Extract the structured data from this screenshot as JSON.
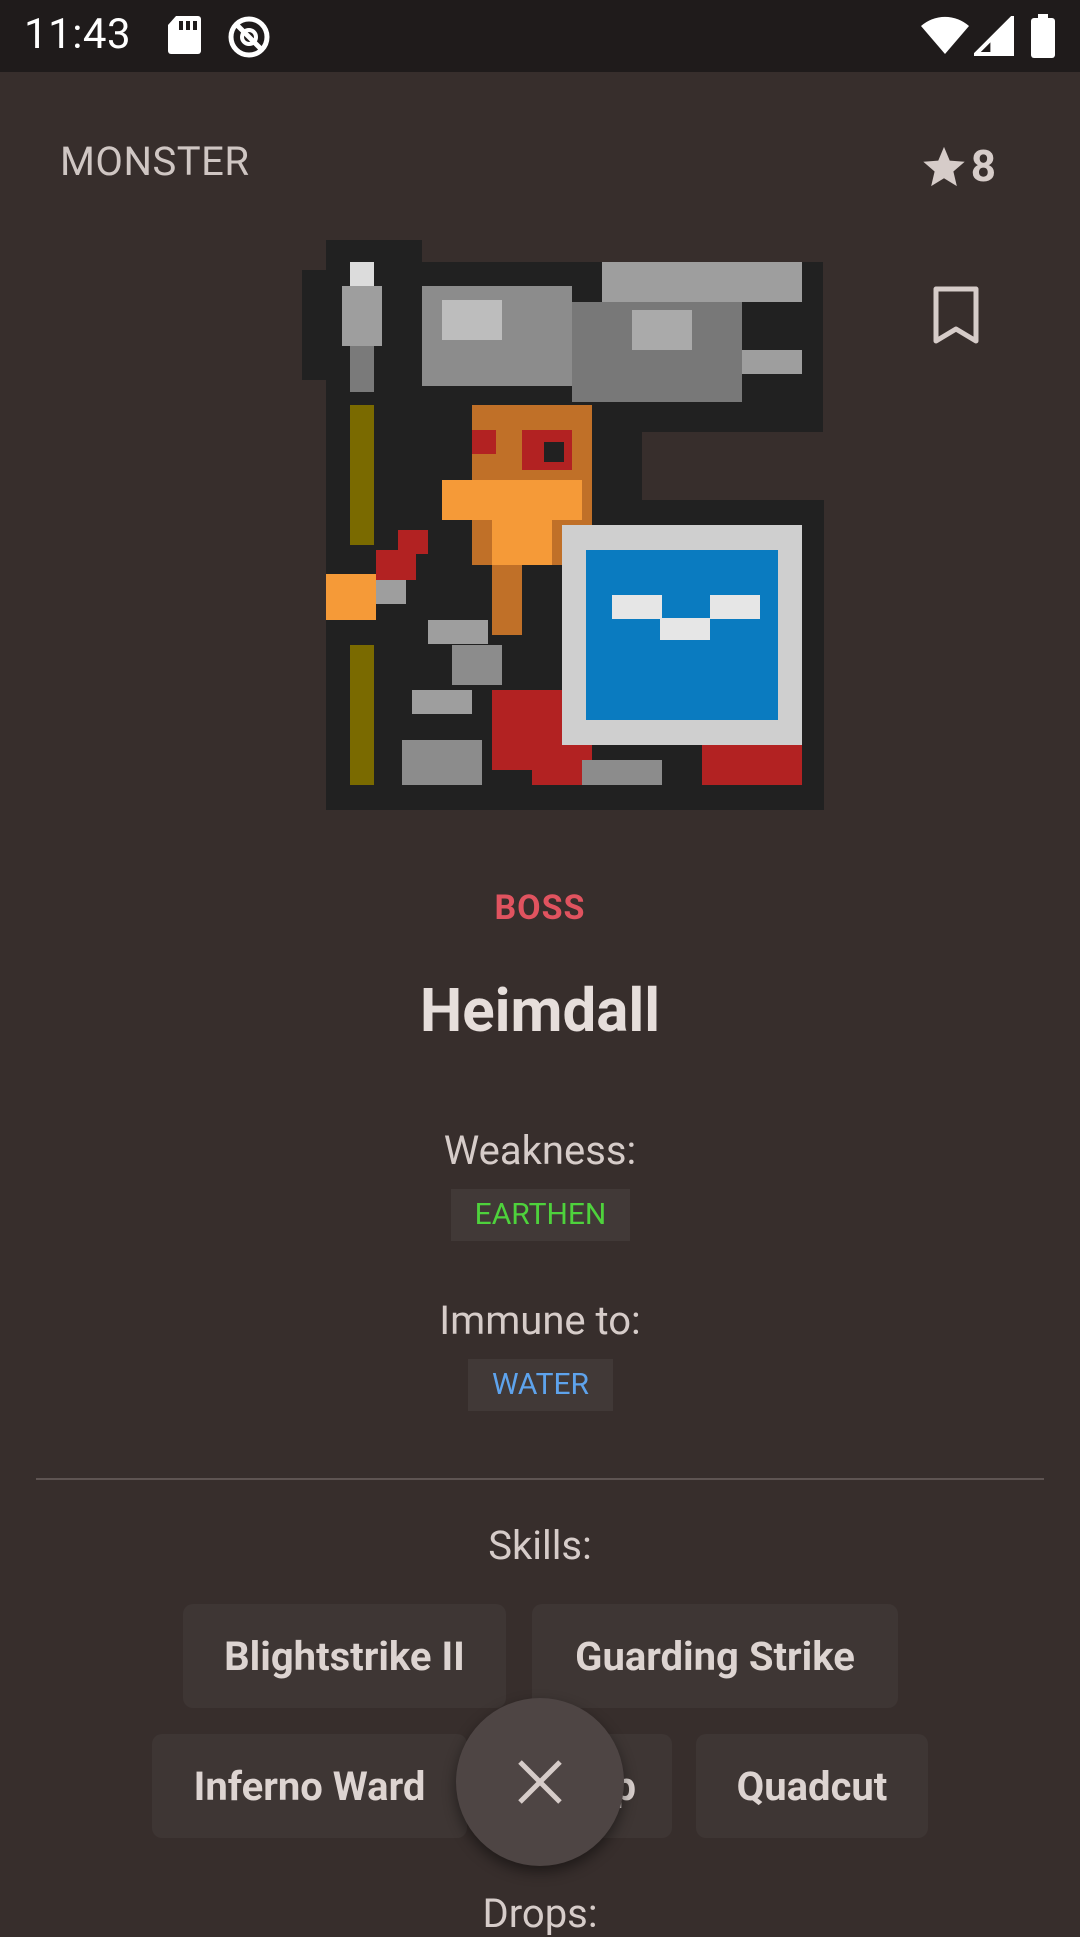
{
  "status_bar": {
    "time": "11:43",
    "icons": [
      "sd-card-icon",
      "no-sync-icon",
      "wifi-icon",
      "signal-icon",
      "battery-icon"
    ]
  },
  "header": {
    "type_label": "MONSTER",
    "rating": "8",
    "rating_icon": "star-icon",
    "bookmark_icon": "bookmark-icon"
  },
  "monster": {
    "rank": "BOSS",
    "name": "Heimdall",
    "weakness_label": "Weakness:",
    "weakness": "EARTHEN",
    "immune_label": "Immune to:",
    "immune": "WATER"
  },
  "skills": {
    "label": "Skills:",
    "items": [
      "Blightstrike II",
      "Guarding Strike",
      "Inferno Ward",
      "p",
      "Quadcut"
    ]
  },
  "drops": {
    "label": "Drops:"
  },
  "fab": {
    "icon": "close-icon"
  },
  "colors": {
    "background": "#372e2c",
    "rank": "#e0535f",
    "earthen": "#4ed23c",
    "water": "#5ea3ec"
  }
}
